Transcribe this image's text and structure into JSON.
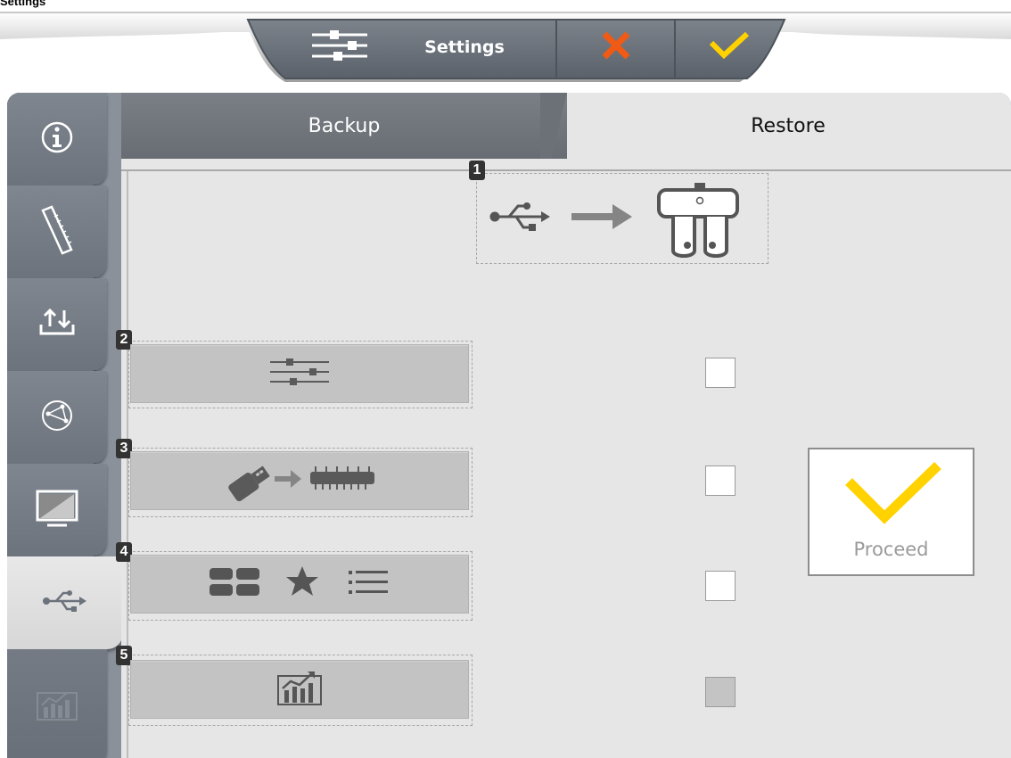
{
  "window": {
    "corner_label": "Settings"
  },
  "header": {
    "settings_label": "Settings",
    "icons": [
      "sliders-icon",
      "close-icon",
      "check-icon"
    ],
    "colors": {
      "cancel": "#f05a14",
      "confirm": "#ffd200",
      "bar": "#646b73"
    }
  },
  "sidebar": {
    "items": [
      {
        "icon": "info-icon"
      },
      {
        "icon": "ruler-icon"
      },
      {
        "icon": "upload-download-icon"
      },
      {
        "icon": "network-icon"
      },
      {
        "icon": "display-icon"
      },
      {
        "icon": "usb-icon",
        "active": true
      },
      {
        "icon": "chart-icon",
        "disabled": true
      }
    ]
  },
  "tabs": [
    {
      "label": "Backup",
      "active": false
    },
    {
      "label": "Restore",
      "active": true
    }
  ],
  "steps": {
    "s1": "1",
    "s2": "2",
    "s3": "3",
    "s4": "4",
    "s5": "5"
  },
  "options": [
    {
      "icon": "sliders-icon",
      "checked": false
    },
    {
      "icon": "usb-to-chip-icon",
      "checked": false
    },
    {
      "icon": "layout-star-list-icon",
      "checked": false
    },
    {
      "icon": "chart-icon",
      "checked": false,
      "disabled": true
    }
  ],
  "proceed": {
    "label": "Proceed",
    "color": "#ffd200"
  }
}
